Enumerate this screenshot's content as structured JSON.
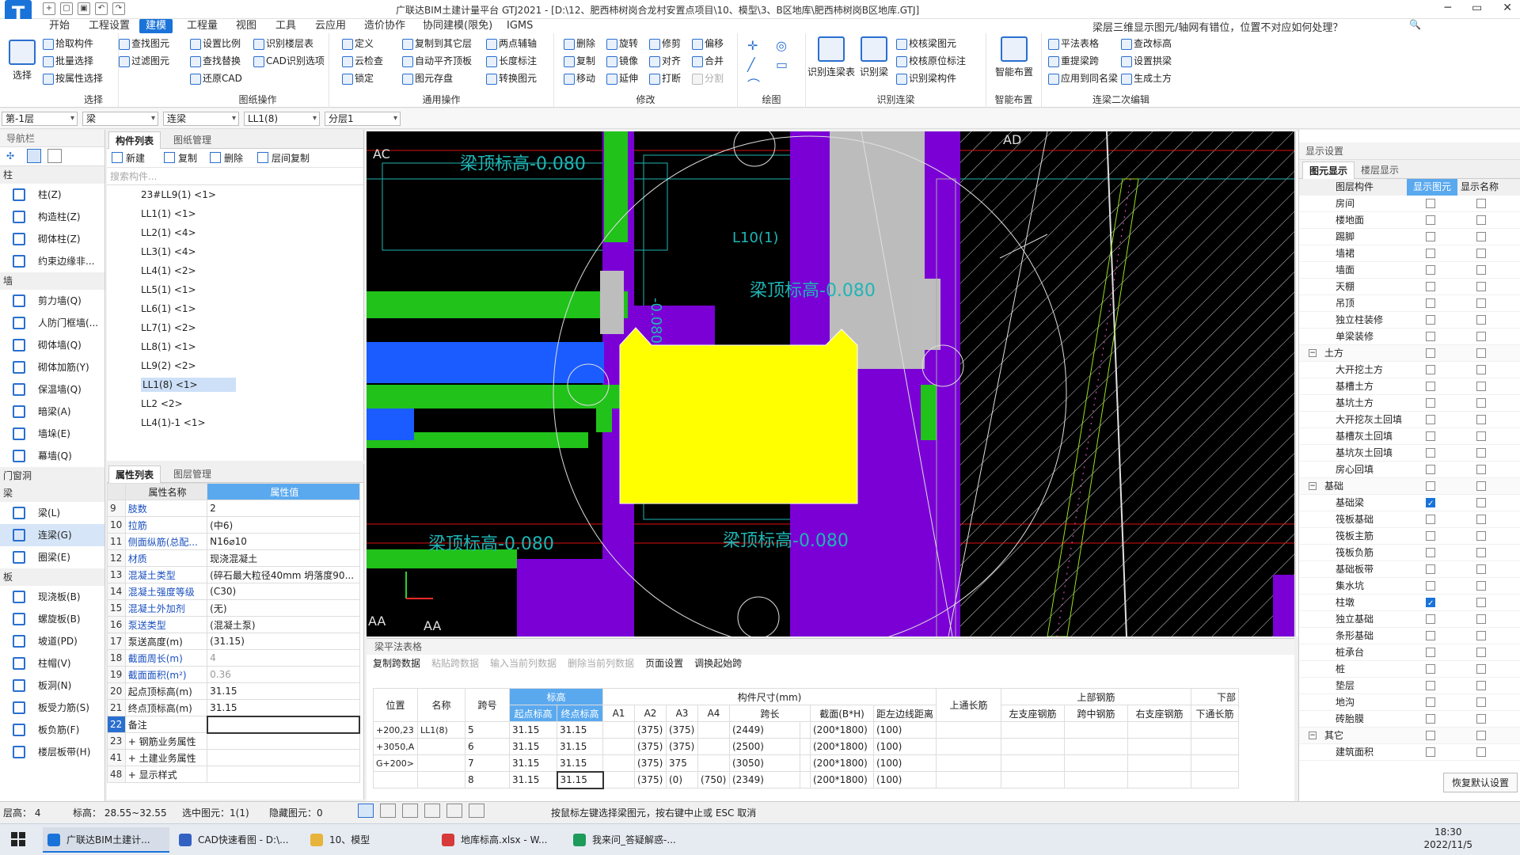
{
  "app": {
    "title": "广联达BIM土建计量平台 GTJ2021 - [D:\\12、肥西柿树岗合龙村安置点项目\\10、模型\\3、B区地库\\肥西柿树岗B区地库.GTJ]",
    "help_question": "梁层三维显示图元/轴网有错位，位置不对应如何处理？"
  },
  "menu": [
    "开始",
    "工程设置",
    "建模",
    "工程量",
    "视图",
    "工具",
    "云应用",
    "造价协作",
    "协同建模(限免)",
    "IGMS"
  ],
  "ribbon": {
    "select": {
      "group": "选择",
      "big": "选择",
      "items": [
        "拾取构件",
        "批量选择",
        "按属性选择",
        "查找图元",
        "过滤图元"
      ]
    },
    "drawing_ops": {
      "group": "图纸操作",
      "items": [
        "设置比例",
        "识别楼层表",
        "查找替换",
        "CAD识别选项",
        "还原CAD"
      ]
    },
    "general_ops": {
      "group": "通用操作",
      "items": [
        "定义",
        "复制到其它层",
        "两点辅轴",
        "云检查",
        "自动平齐顶板",
        "长度标注",
        "锁定",
        "图元存盘",
        "转换图元"
      ]
    },
    "modify": {
      "group": "修改",
      "items": [
        "删除",
        "旋转",
        "修剪",
        "偏移",
        "复制",
        "镜像",
        "对齐",
        "合并",
        "移动",
        "延伸",
        "打断",
        "分割"
      ]
    },
    "draw": {
      "group": "绘图"
    },
    "recognize": {
      "group": "识别连梁",
      "items": [
        "识别连梁表",
        "识别梁",
        "校核梁图元",
        "校核原位标注",
        "识别梁构件"
      ]
    },
    "smart": {
      "group": "智能布置",
      "big": "智能布置"
    },
    "secondary": {
      "group": "连梁二次编辑",
      "items": [
        "平法表格",
        "查改标高",
        "重提梁跨",
        "设置拱梁",
        "应用到同名梁",
        "生成土方"
      ]
    }
  },
  "selectors": [
    "第-1层",
    "梁",
    "连梁",
    "LL1(8)",
    "分层1"
  ],
  "nav": {
    "title": "导航栏",
    "categories": [
      {
        "name": "柱",
        "items": [
          "柱(Z)",
          "构造柱(Z)",
          "砌体柱(Z)",
          "约束边缘非..."
        ]
      },
      {
        "name": "墙",
        "items": [
          "剪力墙(Q)",
          "人防门框墙(...",
          "砌体墙(Q)",
          "砌体加筋(Y)",
          "保温墙(Q)",
          "暗梁(A)",
          "墙垛(E)",
          "幕墙(Q)"
        ]
      },
      {
        "name": "门窗洞",
        "items": []
      },
      {
        "name": "梁",
        "items": [
          "梁(L)",
          "连梁(G)",
          "圈梁(E)"
        ]
      },
      {
        "name": "板",
        "items": [
          "现浇板(B)",
          "螺旋板(B)",
          "坡道(PD)",
          "柱帽(V)",
          "板洞(N)",
          "板受力筋(S)",
          "板负筋(F)",
          "楼层板带(H)"
        ]
      }
    ],
    "selected": "连梁(G)"
  },
  "components": {
    "tabs": [
      "构件列表",
      "图纸管理"
    ],
    "toolbar": [
      "新建",
      "复制",
      "删除",
      "层间复制"
    ],
    "search_placeholder": "搜索构件...",
    "items": [
      "23#LL9(1) <1>",
      "LL1(1) <1>",
      "LL2(1) <4>",
      "LL3(1) <4>",
      "LL4(1) <2>",
      "LL5(1) <1>",
      "LL6(1) <1>",
      "LL7(1) <2>",
      "LL8(1) <1>",
      "LL9(2) <2>",
      "LL1(8) <1>",
      "LL2 <2>",
      "LL4(1)-1 <1>"
    ],
    "selected": "LL1(8) <1>"
  },
  "properties": {
    "tabs": [
      "属性列表",
      "图层管理"
    ],
    "header": [
      "属性名称",
      "属性值"
    ],
    "rows": [
      {
        "n": "9",
        "k": "肢数",
        "v": "2",
        "blue": true
      },
      {
        "n": "10",
        "k": "拉筋",
        "v": "(中6)",
        "blue": true
      },
      {
        "n": "11",
        "k": "侧面纵筋(总配...",
        "v": "N16⌀10",
        "blue": true
      },
      {
        "n": "12",
        "k": "材质",
        "v": "现浇混凝土",
        "blue": true
      },
      {
        "n": "13",
        "k": "混凝土类型",
        "v": "(碎石最大粒径40mm 坍落度90...",
        "blue": true
      },
      {
        "n": "14",
        "k": "混凝土强度等级",
        "v": "(C30)",
        "blue": true
      },
      {
        "n": "15",
        "k": "混凝土外加剂",
        "v": "(无)",
        "blue": true
      },
      {
        "n": "16",
        "k": "泵送类型",
        "v": "(混凝土泵)",
        "blue": true
      },
      {
        "n": "17",
        "k": "泵送高度(m)",
        "v": "(31.15)",
        "blue": false
      },
      {
        "n": "18",
        "k": "截面周长(m)",
        "v": "4",
        "blue": true,
        "gray": true
      },
      {
        "n": "19",
        "k": "截面面积(m²)",
        "v": "0.36",
        "blue": true,
        "gray": true
      },
      {
        "n": "20",
        "k": "起点顶标高(m)",
        "v": "31.15",
        "blue": false
      },
      {
        "n": "21",
        "k": "终点顶标高(m)",
        "v": "31.15",
        "blue": false
      },
      {
        "n": "22",
        "k": "备注",
        "v": "",
        "blue": false
      },
      {
        "n": "23",
        "k": "+ 钢筋业务属性",
        "v": "",
        "blue": false
      },
      {
        "n": "41",
        "k": "+ 土建业务属性",
        "v": "",
        "blue": false
      },
      {
        "n": "48",
        "k": "+ 显示样式",
        "v": "",
        "blue": false
      }
    ]
  },
  "canvas": {
    "axis_labels": [
      "AC",
      "AD",
      "AA",
      "AA"
    ],
    "texts": [
      "梁顶标高-0.080",
      "梁顶标高-0.080",
      "梁顶标高-0.080",
      "梁顶标高-0.080",
      "L10(1)",
      "-0.080"
    ]
  },
  "beam_table": {
    "title": "梁平法表格",
    "ops": [
      "复制跨数据",
      "粘贴跨数据",
      "输入当前列数据",
      "删除当前列数据",
      "页面设置",
      "调换起始跨"
    ],
    "ops_dim": [
      false,
      true,
      true,
      true,
      false,
      false
    ],
    "headers": [
      "位置",
      "名称",
      "跨号",
      "起点标高",
      "终点标高",
      "A1",
      "A2",
      "A3",
      "A4",
      "跨长",
      "截面(B*H)",
      "距左边线距离",
      "上通长筋",
      "左支座钢筋",
      "跨中钢筋",
      "右支座钢筋",
      "下通长筋"
    ],
    "group_headers": {
      "elev": "标高",
      "size": "构件尺寸(mm)",
      "top": "上部钢筋",
      "bottom": "下部"
    },
    "position_text": [
      "+200,23",
      "+3050,A",
      "G+200>"
    ],
    "name_text": "LL1(8)",
    "rows": [
      {
        "idx": "5",
        "span": "5",
        "start": "31.15",
        "end": "31.15",
        "a1": "",
        "a2": "(375)",
        "a3": "(375)",
        "a4": "",
        "len": "(2449)",
        "sec": "(200*1800)",
        "dist": "(100)"
      },
      {
        "idx": "6",
        "span": "6",
        "start": "31.15",
        "end": "31.15",
        "a1": "",
        "a2": "(375)",
        "a3": "(375)",
        "a4": "",
        "len": "(2500)",
        "sec": "(200*1800)",
        "dist": "(100)"
      },
      {
        "idx": "7",
        "span": "7",
        "start": "31.15",
        "end": "31.15",
        "a1": "",
        "a2": "(375)",
        "a3": "375",
        "a4": "",
        "len": "(3050)",
        "sec": "(200*1800)",
        "dist": "(100)"
      },
      {
        "idx": "8",
        "span": "8",
        "start": "31.15",
        "end": "31.15",
        "a1": "",
        "a2": "(375)",
        "a3": "(0)",
        "a4": "(750)",
        "len": "(2349)",
        "sec": "(200*1800)",
        "dist": "(100)"
      }
    ]
  },
  "display_settings": {
    "title": "显示设置",
    "tabs": [
      "图元显示",
      "楼层显示"
    ],
    "headers": [
      "图层构件",
      "显示图元",
      "显示名称"
    ],
    "rows": [
      {
        "label": "房间",
        "cat": false,
        "show": false
      },
      {
        "label": "楼地面",
        "cat": false,
        "show": false
      },
      {
        "label": "踢脚",
        "cat": false,
        "show": false
      },
      {
        "label": "墙裙",
        "cat": false,
        "show": false
      },
      {
        "label": "墙面",
        "cat": false,
        "show": false
      },
      {
        "label": "天棚",
        "cat": false,
        "show": false
      },
      {
        "label": "吊顶",
        "cat": false,
        "show": false
      },
      {
        "label": "独立柱装修",
        "cat": false,
        "show": false
      },
      {
        "label": "单梁装修",
        "cat": false,
        "show": false
      },
      {
        "label": "土方",
        "cat": true,
        "show": false
      },
      {
        "label": "大开挖土方",
        "cat": false,
        "show": false
      },
      {
        "label": "基槽土方",
        "cat": false,
        "show": false
      },
      {
        "label": "基坑土方",
        "cat": false,
        "show": false
      },
      {
        "label": "大开挖灰土回填",
        "cat": false,
        "show": false
      },
      {
        "label": "基槽灰土回填",
        "cat": false,
        "show": false
      },
      {
        "label": "基坑灰土回填",
        "cat": false,
        "show": false
      },
      {
        "label": "房心回填",
        "cat": false,
        "show": false
      },
      {
        "label": "基础",
        "cat": true,
        "show": false
      },
      {
        "label": "基础梁",
        "cat": false,
        "show": true
      },
      {
        "label": "筏板基础",
        "cat": false,
        "show": false
      },
      {
        "label": "筏板主筋",
        "cat": false,
        "show": false
      },
      {
        "label": "筏板负筋",
        "cat": false,
        "show": false
      },
      {
        "label": "基础板带",
        "cat": false,
        "show": false
      },
      {
        "label": "集水坑",
        "cat": false,
        "show": false
      },
      {
        "label": "柱墩",
        "cat": false,
        "show": true
      },
      {
        "label": "独立基础",
        "cat": false,
        "show": false
      },
      {
        "label": "条形基础",
        "cat": false,
        "show": false
      },
      {
        "label": "桩承台",
        "cat": false,
        "show": false
      },
      {
        "label": "桩",
        "cat": false,
        "show": false
      },
      {
        "label": "垫层",
        "cat": false,
        "show": false
      },
      {
        "label": "地沟",
        "cat": false,
        "show": false
      },
      {
        "label": "砖胎膜",
        "cat": false,
        "show": false
      },
      {
        "label": "其它",
        "cat": true,
        "show": false
      },
      {
        "label": "建筑面积",
        "cat": false,
        "show": false
      }
    ],
    "reset_button": "恢复默认设置"
  },
  "status": {
    "floor": "层高：  4",
    "elevation": "标高：  28.55~32.55",
    "selected": "选中图元：1(1)",
    "hidden": "隐藏图元：0",
    "hint": "按鼠标左键选择梁图元，按右键中止或 ESC 取消"
  },
  "taskbar": {
    "items": [
      "广联达BIM土建计...",
      "CAD快速看图 - D:\\...",
      "10、模型",
      "地库标高.xlsx - W...",
      "我来问_答疑解惑-..."
    ],
    "time": "18:30",
    "date": "2022/11/5",
    "colors": [
      "#1a73d9",
      "#3361c2",
      "#e8b33a",
      "#d63a3a",
      "#1d9b5a"
    ]
  }
}
